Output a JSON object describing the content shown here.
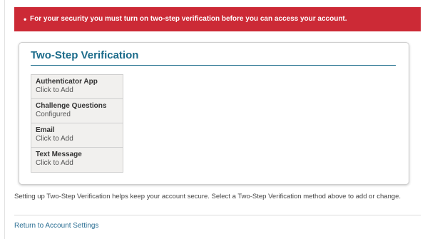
{
  "alert": {
    "bullet": "•",
    "message": "For your security you must turn on two-step verification before you can access your account.",
    "background_color": "#cc2a36"
  },
  "verification": {
    "title": "Two-Step Verification",
    "accent_color": "#1b6b8a",
    "methods": [
      {
        "name": "Authenticator App",
        "status": "Click to Add"
      },
      {
        "name": "Challenge Questions",
        "status": "Configured"
      },
      {
        "name": "Email",
        "status": "Click to Add"
      },
      {
        "name": "Text Message",
        "status": "Click to Add"
      }
    ]
  },
  "help_text": "Setting up Two-Step Verification helps keep your account secure. Select a Two-Step Verification method above to add or change.",
  "return_link": {
    "label": "Return to Account Settings"
  }
}
